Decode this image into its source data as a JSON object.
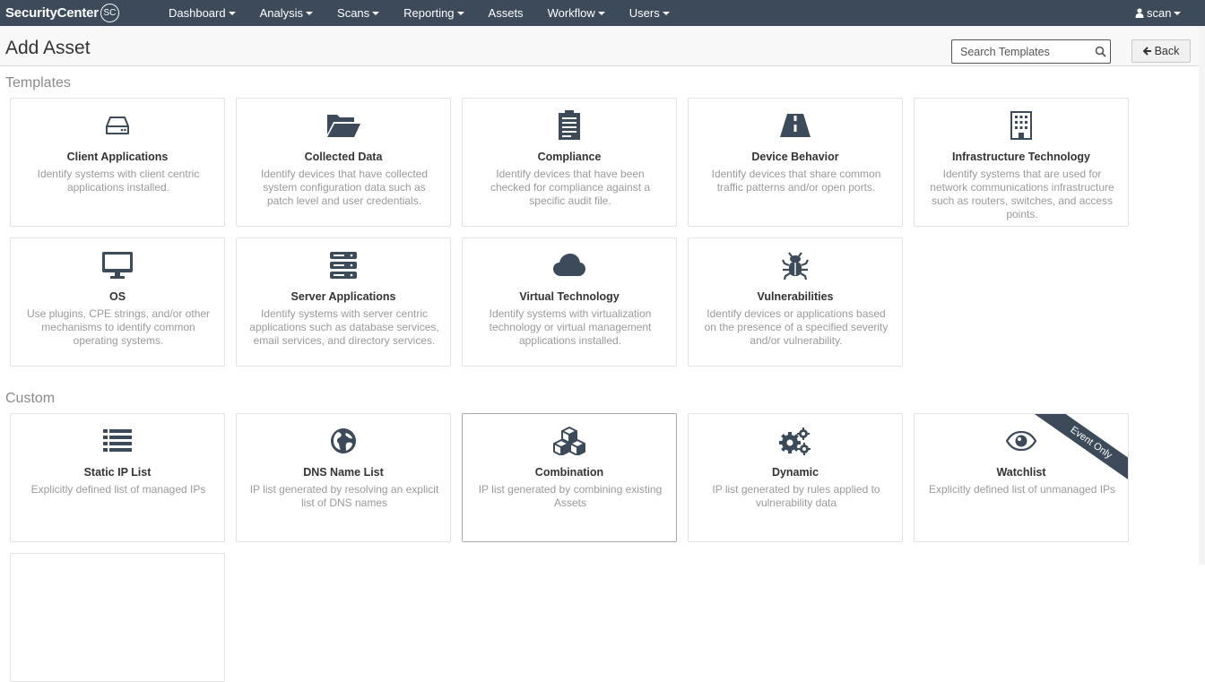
{
  "brand": {
    "name": "SecurityCenter",
    "badge": "SC"
  },
  "nav": [
    {
      "label": "Dashboard",
      "dropdown": true
    },
    {
      "label": "Analysis",
      "dropdown": true
    },
    {
      "label": "Scans",
      "dropdown": true
    },
    {
      "label": "Reporting",
      "dropdown": true
    },
    {
      "label": "Assets",
      "dropdown": false
    },
    {
      "label": "Workflow",
      "dropdown": true
    },
    {
      "label": "Users",
      "dropdown": true
    }
  ],
  "user": {
    "name": "scan",
    "icon": "user-icon"
  },
  "page": {
    "title": "Add Asset"
  },
  "search": {
    "placeholder": "Search Templates",
    "value": ""
  },
  "back_button": {
    "label": "Back",
    "icon": "arrow-left-icon"
  },
  "colors": {
    "navbar": "#3c4a5a",
    "icon": "#3c4a5a",
    "desc": "#9a9a9a"
  },
  "templates": {
    "heading": "Templates",
    "cards": [
      {
        "title": "Client Applications",
        "icon": "hdd-icon",
        "desc": "Identify systems with client centric applications installed."
      },
      {
        "title": "Collected Data",
        "icon": "folder-open-icon",
        "desc": "Identify devices that have collected system configuration data such as patch level and user credentials."
      },
      {
        "title": "Compliance",
        "icon": "clipboard-icon",
        "desc": "Identify devices that have been checked for compliance against a specific audit file."
      },
      {
        "title": "Device Behavior",
        "icon": "road-icon",
        "desc": "Identify devices that share common traffic patterns and/or open ports."
      },
      {
        "title": "Infrastructure Technology",
        "icon": "building-icon",
        "desc": "Identify systems that are used for network communications infrastructure such as routers, switches, and access points."
      },
      {
        "title": "OS",
        "icon": "desktop-icon",
        "desc": "Use plugins, CPE strings, and/or other mechanisms to identify common operating systems."
      },
      {
        "title": "Server Applications",
        "icon": "server-icon",
        "desc": "Identify systems with server centric applications such as database services, email services, and directory services."
      },
      {
        "title": "Virtual Technology",
        "icon": "cloud-icon",
        "desc": "Identify systems with virtualization technology or virtual management applications installed."
      },
      {
        "title": "Vulnerabilities",
        "icon": "bug-icon",
        "desc": "Identify devices or applications based on the presence of a specified severity and/or vulnerability."
      }
    ]
  },
  "custom": {
    "heading": "Custom",
    "cards": [
      {
        "title": "Static IP List",
        "icon": "list-icon",
        "desc": "Explicitly defined list of managed IPs"
      },
      {
        "title": "DNS Name List",
        "icon": "globe-icon",
        "desc": "IP list generated by resolving an explicit list of DNS names"
      },
      {
        "title": "Combination",
        "icon": "cubes-icon",
        "desc": "IP list generated by combining existing Assets"
      },
      {
        "title": "Dynamic",
        "icon": "cogs-icon",
        "desc": "IP list generated by rules applied to vulnerability data"
      },
      {
        "title": "Watchlist",
        "icon": "eye-icon",
        "desc": "Explicitly defined list of unmanaged IPs",
        "ribbon": "Event Only"
      }
    ]
  }
}
